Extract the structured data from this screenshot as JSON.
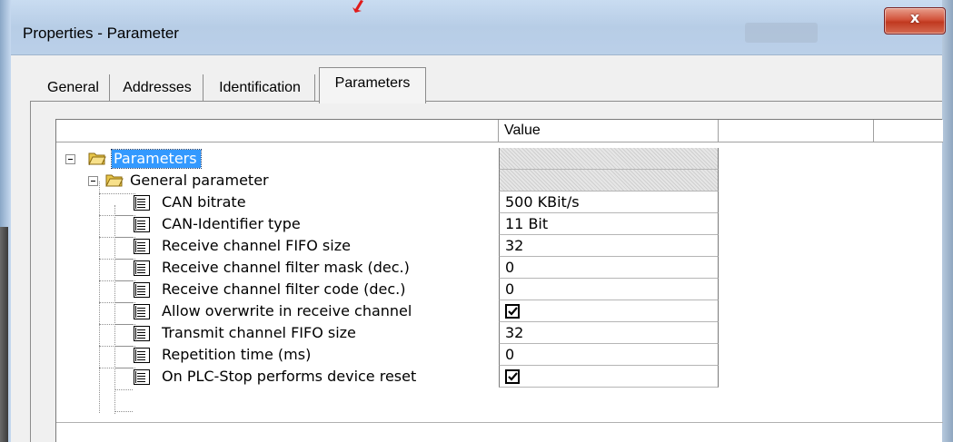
{
  "window": {
    "title": "Properties - Parameter",
    "close_glyph": "x"
  },
  "tabs": [
    {
      "label": "General",
      "active": false
    },
    {
      "label": "Addresses",
      "active": false
    },
    {
      "label": "Identification",
      "active": false
    },
    {
      "label": "Parameters",
      "active": true
    }
  ],
  "grid": {
    "columns": [
      "",
      "Value",
      ""
    ],
    "rows": [
      {
        "name": "Parameters",
        "kind": "folder",
        "value": "",
        "value_type": "hatched",
        "selected": true
      },
      {
        "name": "General parameter",
        "kind": "folder",
        "value": "",
        "value_type": "hatched",
        "selected": false
      },
      {
        "name": "CAN bitrate",
        "kind": "param",
        "value": "500 KBit/s",
        "value_type": "text"
      },
      {
        "name": "CAN-Identifier type",
        "kind": "param",
        "value": "11 Bit",
        "value_type": "text"
      },
      {
        "name": "Receive channel FIFO size",
        "kind": "param",
        "value": "32",
        "value_type": "text"
      },
      {
        "name": "Receive channel filter mask (dec.)",
        "kind": "param",
        "value": "0",
        "value_type": "text"
      },
      {
        "name": "Receive channel filter code (dec.)",
        "kind": "param",
        "value": "0",
        "value_type": "text"
      },
      {
        "name": "Allow overwrite in receive channel",
        "kind": "param",
        "value": "",
        "value_type": "checkbox",
        "checked": true
      },
      {
        "name": "Transmit channel FIFO size",
        "kind": "param",
        "value": "32",
        "value_type": "text"
      },
      {
        "name": "Repetition time (ms)",
        "kind": "param",
        "value": "0",
        "value_type": "text"
      },
      {
        "name": "On PLC-Stop performs device reset",
        "kind": "param",
        "value": "",
        "value_type": "checkbox",
        "checked": true
      }
    ]
  },
  "colors": {
    "selection": "#3399ff",
    "close_button": "#c7432b",
    "window_frame": "#bcd1ea"
  },
  "icons": {
    "folder": "folder-open-icon",
    "param": "parameter-list-icon",
    "expander": "tree-collapse-icon",
    "check": "checkmark-icon",
    "close": "close-icon"
  }
}
